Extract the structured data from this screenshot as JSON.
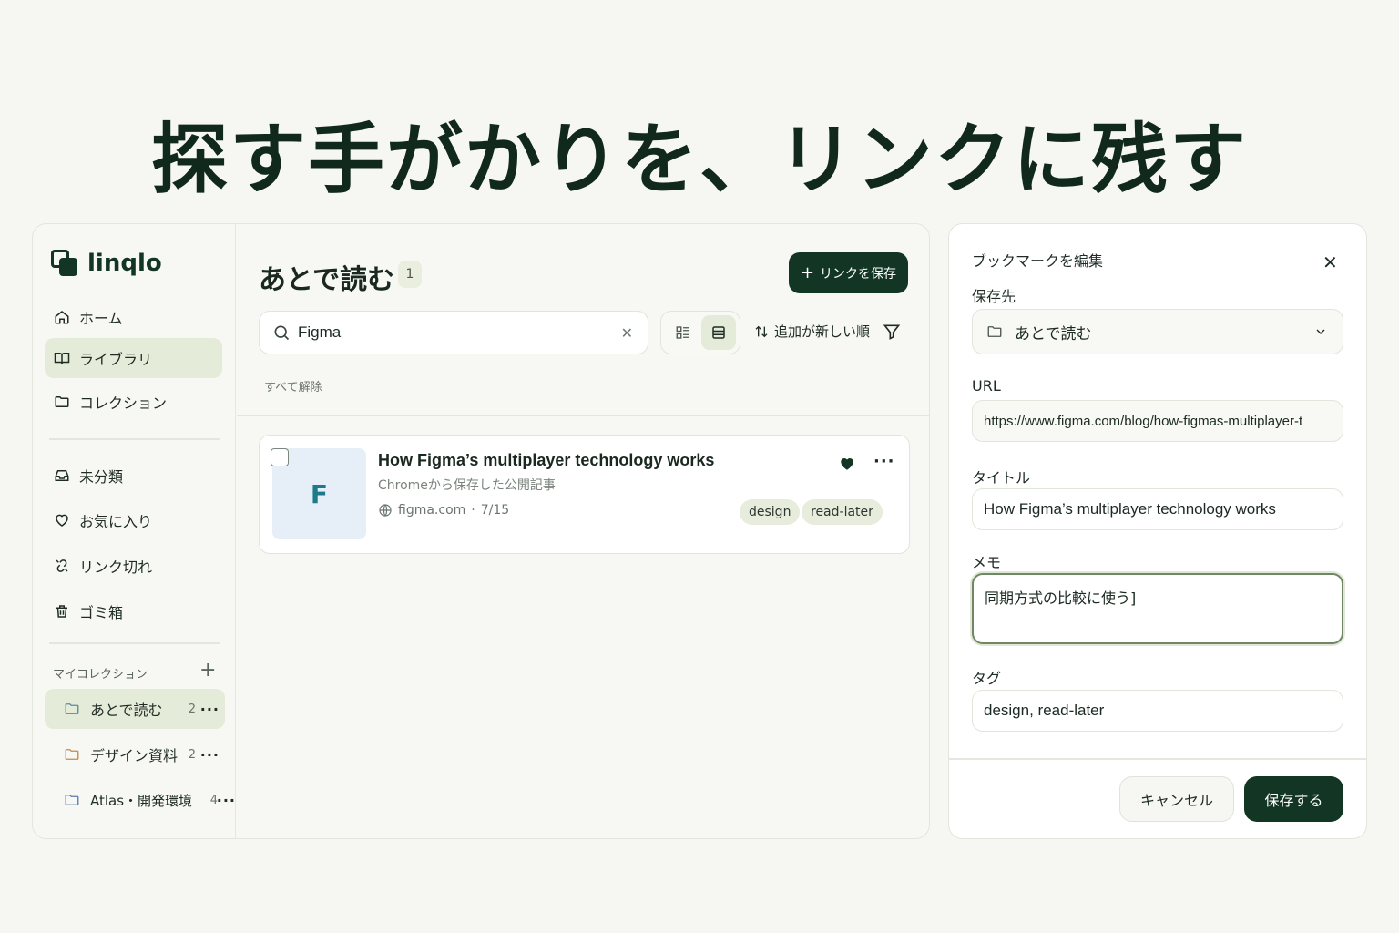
{
  "headline": "探す手がかりを、リンクに残す",
  "app": {
    "logo": "linqlo",
    "nav": [
      {
        "label": "ホーム",
        "icon": "home-icon"
      },
      {
        "label": "ライブラリ",
        "icon": "book-icon",
        "active": true
      },
      {
        "label": "コレクション",
        "icon": "folder-icon"
      }
    ],
    "filters": [
      {
        "label": "未分類",
        "icon": "inbox-icon"
      },
      {
        "label": "お気に入り",
        "icon": "heart-icon"
      },
      {
        "label": "リンク切れ",
        "icon": "broken-link-icon"
      },
      {
        "label": "ゴミ箱",
        "icon": "trash-icon"
      }
    ],
    "my_collections_label": "マイコレクション",
    "collections": [
      {
        "label": "あとで読む",
        "count": "2",
        "active": true
      },
      {
        "label": "デザイン資料",
        "count": "2"
      },
      {
        "label": "Atlas・開発環境",
        "count": "4"
      }
    ]
  },
  "main": {
    "title": "あとで読む",
    "count": "1",
    "save_button": "リンクを保存",
    "search_value": "Figma",
    "sort_label": "追加が新しい順",
    "clear_all": "すべて解除",
    "card": {
      "thumb_letter": "F",
      "title": "How Figma’s multiplayer technology works",
      "subtitle": "Chromeから保存した公開記事",
      "domain": "figma.com",
      "date": "7/15",
      "tags": [
        "design",
        "read-later"
      ]
    }
  },
  "panel": {
    "title": "ブックマークを編集",
    "dest_label": "保存先",
    "dest_value": "あとで読む",
    "url_label": "URL",
    "url_value": "https://www.figma.com/blog/how-figmas-multiplayer-t",
    "title_label": "タイトル",
    "title_value": "How Figma’s multiplayer technology works",
    "memo_label": "メモ",
    "memo_value": "同期方式の比較に使う]",
    "tag_label": "タグ",
    "tag_value": "design, read-later",
    "cancel": "キャンセル",
    "save": "保存する"
  },
  "colors": {
    "accent": "#123524",
    "active_bg": "#e4ebd8",
    "tag_bg": "#e7ecdc"
  }
}
